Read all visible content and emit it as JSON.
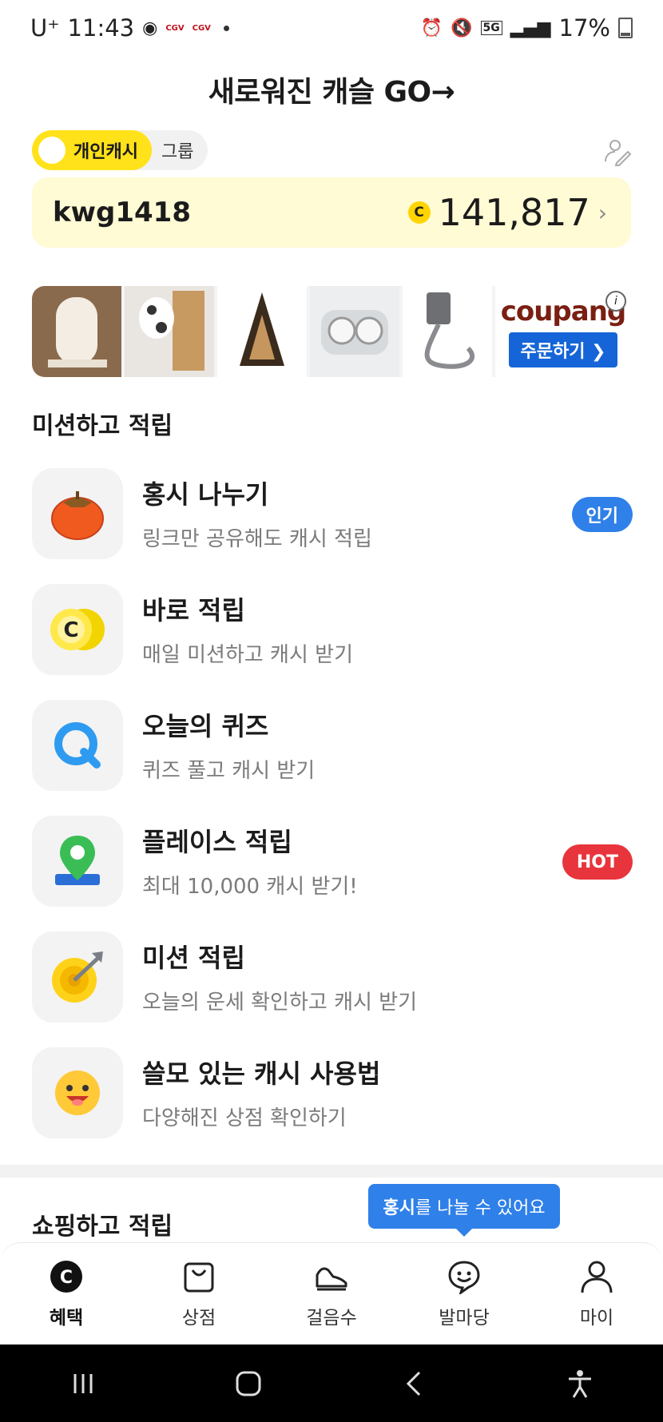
{
  "status_bar": {
    "carrier": "U⁺",
    "time": "11:43",
    "battery": "17%",
    "network": "5G"
  },
  "banner": {
    "title": "새로워진 캐슬  GO→"
  },
  "segment": {
    "personal": "개인캐시",
    "group": "그룹"
  },
  "account": {
    "user_id": "kwg1418",
    "coin_symbol": "C",
    "cash": "141,817",
    "chevron": "›"
  },
  "ad": {
    "brand": "coupang",
    "order_label": "주문하기 ❯",
    "info": "i",
    "product_icons": [
      "whiteboard-product",
      "cat-scratcher-product",
      "triangle-stand-product",
      "earbuds-product",
      "usb-cable-product"
    ]
  },
  "missions": {
    "section_title": "미션하고 적립",
    "items": [
      {
        "title": "홍시 나누기",
        "subtitle": "링크만 공유해도 캐시 적립",
        "badge": "인기",
        "icon": "persimmon-icon"
      },
      {
        "title": "바로 적립",
        "subtitle": "매일 미션하고 캐시 받기",
        "badge": "",
        "icon": "coin-icon"
      },
      {
        "title": "오늘의 퀴즈",
        "subtitle": "퀴즈 풀고 캐시 받기",
        "badge": "",
        "icon": "quiz-icon"
      },
      {
        "title": "플레이스 적립",
        "subtitle": "최대 10,000 캐시 받기!",
        "badge": "HOT",
        "icon": "map-pin-icon"
      },
      {
        "title": "미션 적립",
        "subtitle": "오늘의 운세 확인하고 캐시 받기",
        "badge": "",
        "icon": "target-icon"
      },
      {
        "title": "쓸모 있는 캐시 사용법",
        "subtitle": "다양해진 상점 확인하기",
        "badge": "",
        "icon": "smiley-icon"
      }
    ]
  },
  "shopping": {
    "section_title": "쇼핑하고 적립"
  },
  "tooltip": {
    "bold": "홍시",
    "rest": "를 나눌 수 있어요"
  },
  "bottom_nav": [
    {
      "label": "혜택",
      "icon": "coin-c-icon",
      "active": true
    },
    {
      "label": "상점",
      "icon": "shopping-bag-icon",
      "active": false
    },
    {
      "label": "걸음수",
      "icon": "sneaker-icon",
      "active": false
    },
    {
      "label": "발마당",
      "icon": "chat-smile-icon",
      "active": false
    },
    {
      "label": "마이",
      "icon": "person-icon",
      "active": false
    }
  ],
  "colors": {
    "accent_yellow": "#ffe21a",
    "card_bg": "#fffbd5",
    "blue": "#2f80e8",
    "red": "#e8343c"
  }
}
